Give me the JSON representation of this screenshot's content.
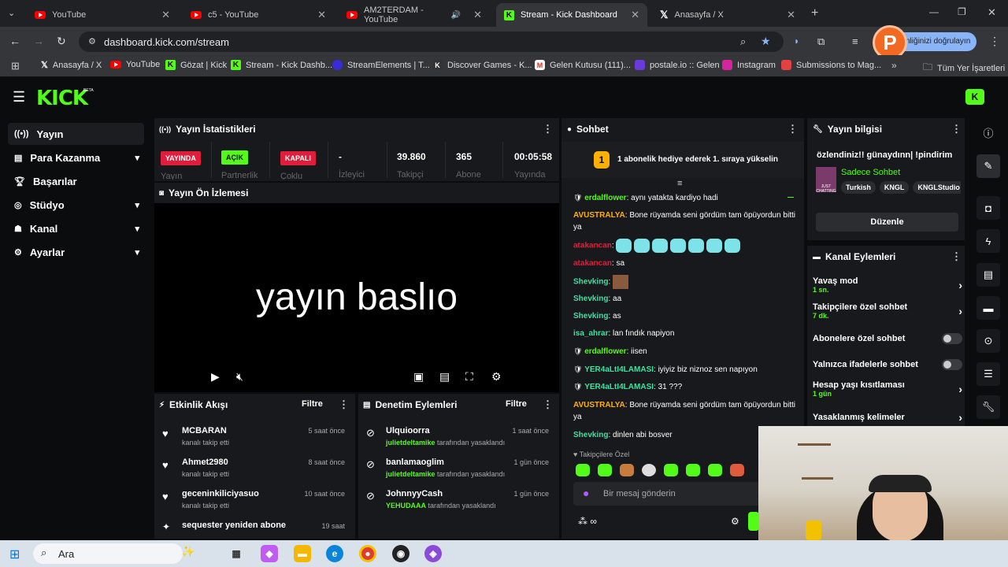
{
  "browser": {
    "tabs": [
      {
        "label": "YouTube",
        "icon": "youtube-icon"
      },
      {
        "label": "c5 - YouTube",
        "icon": "youtube-icon"
      },
      {
        "label": "AM2TERDAM - YouTube",
        "icon": "youtube-icon"
      },
      {
        "label": "Stream - Kick Dashboard",
        "icon": "kick-icon"
      },
      {
        "label": "Anasayfa / X",
        "icon": "x-icon"
      }
    ],
    "url": "dashboard.kick.com/stream",
    "profile_prompt": "nliğinizi doğrulayın",
    "bookmarks": [
      "Anasayfa / X",
      "YouTube",
      "Gözat | Kick",
      "Stream - Kick Dashb...",
      "StreamElements | T...",
      "Discover Games - K...",
      "Gelen Kutusu (111)...",
      "postale.io :: Gelen",
      "Instagram",
      "Submissions to Mag..."
    ],
    "all_bookmarks": "Tüm Yer İşaretleri"
  },
  "kick": {
    "logo": "KICK",
    "beta": "BETA"
  },
  "sidebar": {
    "items": [
      {
        "label": "Yayın",
        "icon": "broadcast-icon"
      },
      {
        "label": "Para Kazanma",
        "icon": "money-icon"
      },
      {
        "label": "Başarılar",
        "icon": "trophy-icon"
      },
      {
        "label": "Stüdyo",
        "icon": "studio-icon"
      },
      {
        "label": "Kanal",
        "icon": "channel-icon"
      },
      {
        "label": "Ayarlar",
        "icon": "gear-icon"
      }
    ]
  },
  "stats": {
    "title": "Yayın İstatistikleri",
    "live_badge": "YAYINDA",
    "live_label": "Yayın",
    "partner_badge": "AÇIK",
    "partner_label": "Partnerlik",
    "multi_badge": "KAPALI",
    "multi_label": "Çoklu",
    "viewers": "-",
    "viewers_label": "İzleyici",
    "followers": "39.860",
    "followers_label": "Takipçi",
    "subs": "365",
    "subs_label": "Abone",
    "uptime": "00:05:58",
    "uptime_label": "Yayında"
  },
  "preview": {
    "title": "Yayın Ön İzlemesi",
    "overlay_text": "yayın baslıo"
  },
  "activity": {
    "title": "Etkinlik Akışı",
    "filter": "Filtre",
    "items": [
      {
        "name": "MCBARAN",
        "desc": "kanalı takip etti",
        "time": "5 saat önce"
      },
      {
        "name": "Ahmet2980",
        "desc": "kanalı takip etti",
        "time": "8 saat önce"
      },
      {
        "name": "geceninkiliciyasuo",
        "desc": "kanalı takip etti",
        "time": "10 saat önce"
      },
      {
        "name": "sequester yeniden abone",
        "desc": "",
        "time": "19 saat"
      }
    ]
  },
  "moderation": {
    "title": "Denetim Eylemleri",
    "filter": "Filtre",
    "items": [
      {
        "name": "Ulquioorra",
        "mod": "julietdeltamike",
        "desc": "tarafından yasaklandı",
        "time": "1 saat önce"
      },
      {
        "name": "banlamaoglim",
        "mod": "julietdeltamike",
        "desc": "tarafından yasaklandı",
        "time": "1 gün önce"
      },
      {
        "name": "JohnnyyCash",
        "mod": "YEHUDAAA",
        "desc": "tarafından yasaklandı",
        "time": "1 gün önce"
      }
    ]
  },
  "chat": {
    "title": "Sohbet",
    "goal_number": "1",
    "goal_text": "1 abonelik hediye ederek 1. sıraya yükselin",
    "messages": [
      {
        "user": "erdalflower",
        "text": ": aynı yatakta kardiyo hadi"
      },
      {
        "user": "AVUSTRALYA",
        "text": ": Bone rüyamda seni gördüm tam öpüyordun bitti ya"
      },
      {
        "user": "atakancan",
        "text": ":"
      },
      {
        "user": "atakancan",
        "text": ": sa"
      },
      {
        "user": "Shevking",
        "text": ":"
      },
      {
        "user": "Shevking",
        "text": ": aa"
      },
      {
        "user": "Shevking",
        "text": ": as"
      },
      {
        "user": "isa_ahrar",
        "text": ": lan fındık napiyon"
      },
      {
        "user": "erdalflower",
        "text": ": iisen"
      },
      {
        "user": "YER4aLtI4LAMASI",
        "text": ": iyiyiz biz niznoz sen napıyon"
      },
      {
        "user": "YER4aLtI4LAMASI",
        "text": ": 31 ???"
      },
      {
        "user": "AVUSTRALYA",
        "text": ": Bone rüyamda seni gördüm tam öpüyordun bitti ya"
      },
      {
        "user": "Shevking",
        "text": ": dinlen abi bosver"
      }
    ],
    "follower_only": "Takipçilere Özel",
    "input_placeholder": "Bir mesaj gönderin"
  },
  "stream_info": {
    "title": "Yayın bilgisi",
    "stream_title": "özlendiniz!! günaydınn| !pindirim",
    "category": "Sadece Sohbet",
    "thumb_text": "JUST CHATTING",
    "tags": [
      "Turkish",
      "KNGL",
      "KNGLStudio"
    ],
    "edit_button": "Düzenle"
  },
  "channel_actions": {
    "title": "Kanal Eylemleri",
    "rows": [
      {
        "label": "Yavaş mod",
        "sub": "1 sn."
      },
      {
        "label": "Takipçilere özel sohbet",
        "sub": "7 dk."
      },
      {
        "label": "Abonelere özel sohbet",
        "sub": ""
      },
      {
        "label": "Yalnızca ifadelerle sohbet",
        "sub": ""
      },
      {
        "label": "Hesap yaşı kısıtlaması",
        "sub": "1 gün"
      },
      {
        "label": "Yasaklanmış kelimeler",
        "sub": ""
      }
    ]
  },
  "taskbar": {
    "search": "Ara"
  },
  "colors": {
    "accent": "#53fc18",
    "live_red": "#e01e3c",
    "panel": "#18191c",
    "background": "#0b0c0e"
  }
}
